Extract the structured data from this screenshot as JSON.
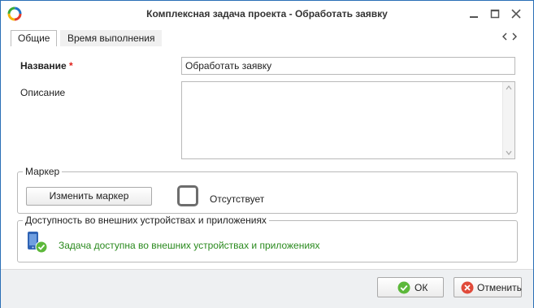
{
  "window": {
    "title": "Комплексная задача проекта - Обработать заявку",
    "controls": [
      "minimize-icon",
      "maximize-icon",
      "close-icon"
    ]
  },
  "tabs": [
    {
      "label": "Общие",
      "active": true
    },
    {
      "label": "Время выполнения",
      "active": false
    }
  ],
  "form": {
    "name_label": "Название",
    "required_mark": "*",
    "name_value": "Обработать заявку",
    "description_label": "Описание",
    "description_value": ""
  },
  "marker_group": {
    "legend": "Маркер",
    "change_button": "Изменить маркер",
    "status": "Отсутствует"
  },
  "availability_group": {
    "legend": "Доступность во внешних устройствах и приложениях",
    "message": "Задача доступна во внешних устройствах и приложениях"
  },
  "footer": {
    "ok_label": "ОК",
    "cancel_label": "Отменить"
  },
  "colors": {
    "accent_border": "#2a6fb6",
    "required": "#e0201a",
    "success_text": "#2a8a1e",
    "phone_blue": "#2f63b4",
    "check_green": "#5cb83a",
    "cancel_red": "#e04a3a"
  }
}
